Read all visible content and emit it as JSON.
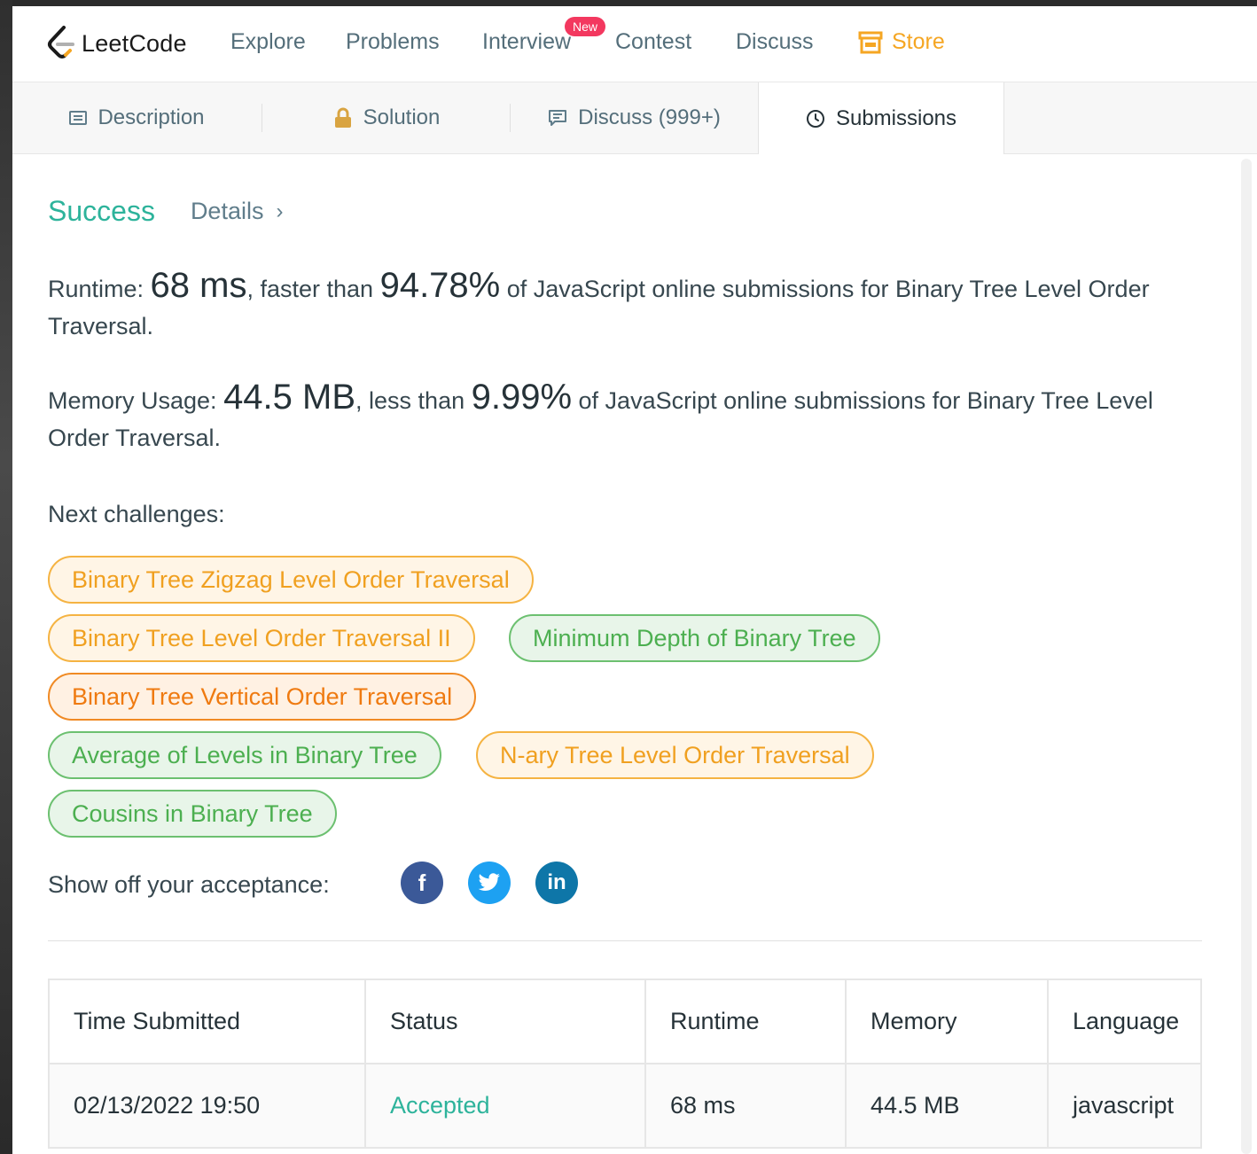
{
  "nav": {
    "logo_text": "LeetCode",
    "items": [
      "Explore",
      "Problems",
      "Interview",
      "Contest",
      "Discuss"
    ],
    "badge": "New",
    "store": "Store",
    "brand_color": "#f5a623"
  },
  "tabs": {
    "description": "Description",
    "solution": "Solution",
    "discuss": "Discuss (999+)",
    "submissions": "Submissions",
    "active": "Submissions"
  },
  "result": {
    "status": "Success",
    "details": "Details",
    "runtime_label": "Runtime: ",
    "runtime_value": "68 ms",
    "runtime_mid": ", faster than ",
    "runtime_pct": "94.78%",
    "runtime_tail": " of JavaScript online submissions for Binary Tree Level Order Traversal.",
    "memory_label": "Memory Usage: ",
    "memory_value": "44.5 MB",
    "memory_mid": ", less than ",
    "memory_pct": "9.99%",
    "memory_tail": " of JavaScript online submissions for Binary Tree Level Order Traversal."
  },
  "next_challenges": {
    "label": "Next challenges:",
    "items": [
      {
        "title": "Binary Tree Zigzag Level Order Traversal",
        "difficulty": "medium"
      },
      {
        "title": "Binary Tree Level Order Traversal II",
        "difficulty": "medium"
      },
      {
        "title": "Minimum Depth of Binary Tree",
        "difficulty": "easy"
      },
      {
        "title": "Binary Tree Vertical Order Traversal",
        "difficulty": "hard"
      },
      {
        "title": "Average of Levels in Binary Tree",
        "difficulty": "easy"
      },
      {
        "title": "N-ary Tree Level Order Traversal",
        "difficulty": "medium"
      },
      {
        "title": "Cousins in Binary Tree",
        "difficulty": "easy"
      }
    ]
  },
  "share": {
    "label": "Show off your acceptance:",
    "networks": [
      {
        "name": "facebook",
        "icon": "f",
        "color": "#3b5998"
      },
      {
        "name": "twitter",
        "icon": "twitter-bird",
        "color": "#1da1f2"
      },
      {
        "name": "linkedin",
        "icon": "in",
        "color": "#0e76a8"
      }
    ]
  },
  "submissions_table": {
    "headers": [
      "Time Submitted",
      "Status",
      "Runtime",
      "Memory",
      "Language"
    ],
    "rows": [
      {
        "time": "02/13/2022 19:50",
        "status": "Accepted",
        "runtime": "68 ms",
        "memory": "44.5 MB",
        "language": "javascript"
      }
    ]
  },
  "colors": {
    "success": "#2db39b",
    "medium": "#f0a020",
    "easy": "#4caf50",
    "hard": "#ef7a10"
  }
}
